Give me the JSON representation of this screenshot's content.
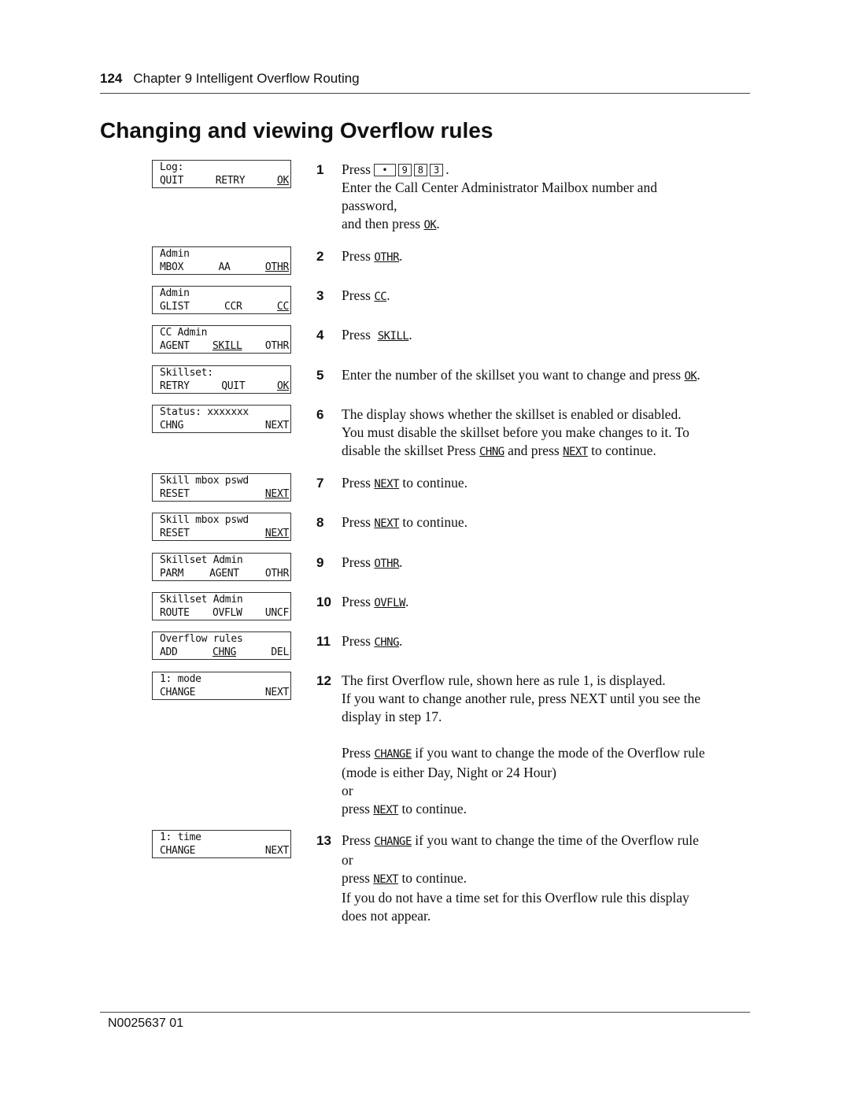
{
  "header": {
    "page_number": "124",
    "chapter": "Chapter 9  Intelligent Overflow Routing"
  },
  "title": "Changing and viewing Overflow rules",
  "displays": [
    {
      "line1": "Log:",
      "keys": [
        "QUIT",
        "RETRY",
        "OK"
      ],
      "underlined": 2
    },
    {
      "line1": "Admin",
      "keys": [
        "MBOX",
        "AA",
        "OTHR"
      ],
      "underlined": 2
    },
    {
      "line1": "Admin",
      "keys": [
        "GLIST",
        "CCR",
        "CC"
      ],
      "underlined": 2
    },
    {
      "line1": "CC Admin",
      "keys": [
        "AGENT",
        "SKILL",
        "OTHR"
      ],
      "underlined": 1
    },
    {
      "line1": "Skillset:",
      "keys": [
        "RETRY",
        "QUIT",
        "OK"
      ],
      "underlined": 2
    },
    {
      "line1": "Status: xxxxxxx",
      "keys": [
        "CHNG",
        "NEXT"
      ],
      "underlined": -1
    },
    {
      "line1": "Skill mbox pswd",
      "keys": [
        "RESET",
        "NEXT"
      ],
      "underlined": 1
    },
    {
      "line1": "Skill mbox pswd",
      "keys": [
        "RESET",
        "NEXT"
      ],
      "underlined": 1
    },
    {
      "line1": "Skillset Admin",
      "keys": [
        "PARM",
        "AGENT",
        "OTHR"
      ],
      "underlined": -1
    },
    {
      "line1": "Skillset Admin",
      "keys": [
        "ROUTE",
        "OVFLW",
        "UNCF"
      ],
      "underlined": -1
    },
    {
      "line1": "Overflow rules",
      "keys": [
        "ADD",
        "CHNG",
        "DEL"
      ],
      "underlined": 1
    },
    {
      "line1": "1: mode",
      "keys": [
        "CHANGE",
        "NEXT"
      ],
      "underlined": -1
    },
    {
      "line1": "1: time",
      "keys": [
        "CHANGE",
        "NEXT"
      ],
      "underlined": -1
    }
  ],
  "steps": {
    "s1": {
      "num": "1",
      "press": "Press",
      "keys": [
        "•",
        "9",
        "8",
        "3"
      ],
      "line2": "Enter the Call Center Administrator Mailbox number and",
      "line3": "password,",
      "line4a": "and then press",
      "line4k": "OK"
    },
    "s2": {
      "num": "2",
      "a": "Press",
      "k": "OTHR"
    },
    "s3": {
      "num": "3",
      "a": "Press",
      "k": "CC"
    },
    "s4": {
      "num": "4",
      "a": "Press",
      "k": "SKILL"
    },
    "s5": {
      "num": "5",
      "a": "Enter the number of the skillset you want to change and press",
      "k": "OK"
    },
    "s6": {
      "num": "6",
      "line1": "The display shows whether the skillset is enabled or disabled.",
      "line2": "You must disable the skillset before you make changes to it. To",
      "line3a": "disable the skillset Press",
      "k1": "CHNG",
      "line3b": "and press",
      "k2": "NEXT",
      "line3c": "to continue."
    },
    "s7": {
      "num": "7",
      "a": "Press",
      "k": "NEXT",
      "b": "to continue."
    },
    "s8": {
      "num": "8",
      "a": "Press",
      "k": "NEXT",
      "b": "to continue."
    },
    "s9": {
      "num": "9",
      "a": "Press",
      "k": "OTHR"
    },
    "s10": {
      "num": "10",
      "a": "Press",
      "k": "OVFLW"
    },
    "s11": {
      "num": "11",
      "a": "Press",
      "k": "CHNG"
    },
    "s12": {
      "num": "12",
      "line1": "The first Overflow rule, shown here as rule 1, is displayed.",
      "line2": "If you want to change another rule, press NEXT until you see the",
      "line3": "display in step 17.",
      "p2a": "Press",
      "p2k": "CHANGE",
      "p2b": "if you want to change the mode of the Overflow rule",
      "p2line2": "(mode is either Day, Night or 24 Hour)",
      "or": "or",
      "p3a": "press",
      "p3k": "NEXT",
      "p3b": "to continue."
    },
    "s13": {
      "num": "13",
      "a": "Press",
      "k": "CHANGE",
      "b": "if you want to change the time of the Overflow rule",
      "or": "or",
      "p2a": "press",
      "p2k": "NEXT",
      "p2b": "to continue.",
      "line4": "If you do not have a time set for this Overflow rule this display",
      "line5": "does not appear."
    }
  },
  "footer": {
    "doc_id": "N0025637 01"
  }
}
